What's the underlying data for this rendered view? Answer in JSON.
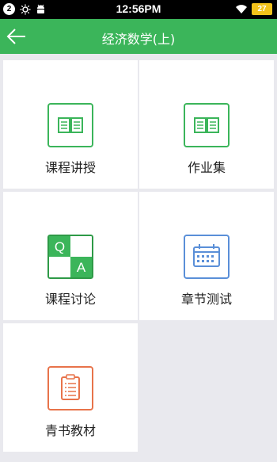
{
  "status_bar": {
    "notification_count": "2",
    "time": "12:56PM",
    "battery": "27"
  },
  "nav": {
    "title": "经济数学(上)"
  },
  "tiles": [
    {
      "label": "课程讲授",
      "icon": "book-icon",
      "color": "#3bb55a"
    },
    {
      "label": "作业集",
      "icon": "book-icon",
      "color": "#3bb55a"
    },
    {
      "label": "课程讨论",
      "icon": "qa-icon",
      "color": "#3bb55a"
    },
    {
      "label": "章节测试",
      "icon": "calendar-icon",
      "color": "#5a8fd8"
    },
    {
      "label": "青书教材",
      "icon": "clipboard-icon",
      "color": "#e8734a"
    }
  ]
}
